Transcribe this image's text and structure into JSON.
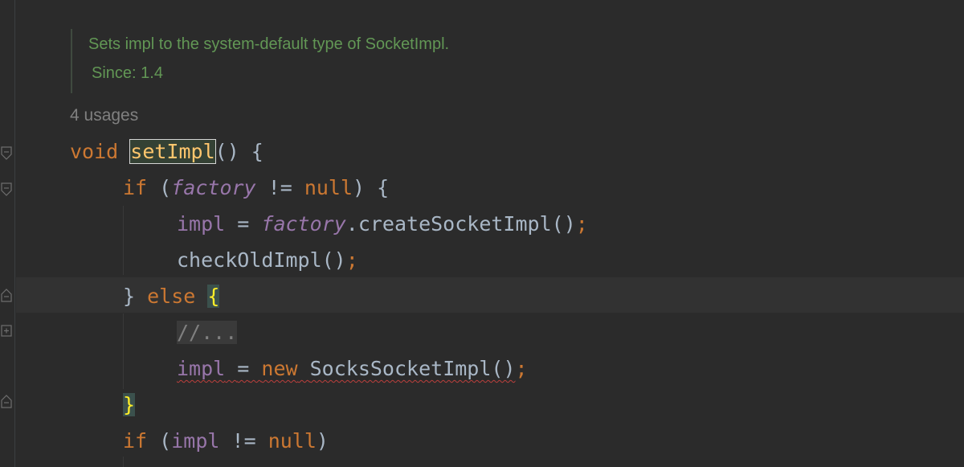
{
  "javadoc": {
    "description": "Sets impl to the system-default type of SocketImpl.",
    "since": "Since: 1.4"
  },
  "usages": "4 usages",
  "code": {
    "l1": {
      "kw_void": "void",
      "method": "setImpl",
      "rest": "() {"
    },
    "l2": {
      "kw_if": "if",
      "open": "(",
      "factory": "factory",
      "ne": "!=",
      "kw_null": "null",
      "close": ") {"
    },
    "l3": {
      "impl": "impl",
      "eq": "=",
      "factory": "factory",
      "call": ".createSocketImpl()",
      "semi": ";"
    },
    "l4": {
      "call": "checkOldImpl()",
      "semi": ";"
    },
    "l5": {
      "brace": "}",
      "kw_else": "else",
      "open_brace": "{"
    },
    "l6": {
      "folded": "//..."
    },
    "l7": {
      "impl": "impl",
      "eq": "=",
      "kw_new": "new",
      "cls": "SocksSocketImpl()",
      "semi": ";"
    },
    "l8": {
      "brace": "}"
    },
    "l9": {
      "kw_if": "if",
      "open": "(",
      "impl": "impl",
      "ne": "!=",
      "kw_null": "null",
      "close": ")"
    }
  },
  "colors": {
    "background": "#2b2b2b",
    "keyword": "#cc7832",
    "field": "#9876aa",
    "doc": "#629755",
    "method": "#ffc66d"
  }
}
